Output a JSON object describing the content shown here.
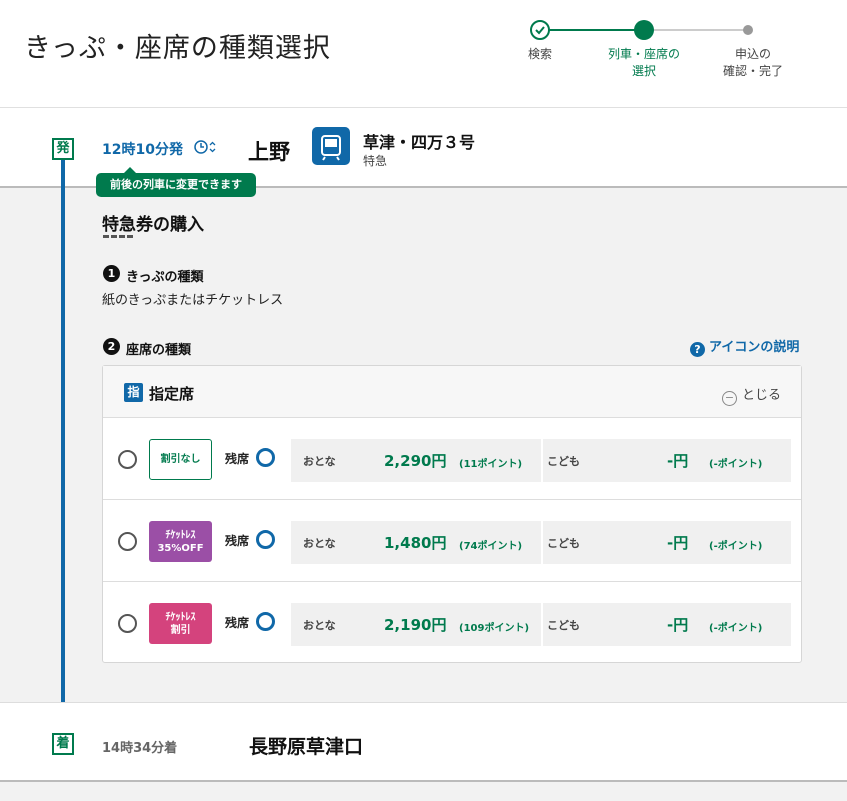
{
  "header": {
    "title": "きっぷ・座席の種類選択",
    "steps": [
      {
        "label": "検索",
        "state": "done"
      },
      {
        "label": "列車・座席の\n選択",
        "state": "current"
      },
      {
        "label": "申込の\n確認・完了",
        "state": "todo"
      }
    ]
  },
  "departure": {
    "badge": "発",
    "time": "12時10分発",
    "station": "上野",
    "train_name": "草津・四万３号",
    "train_type": "特急",
    "tooltip": "前後の列車に変更できます",
    "icons": [
      "clock-icon",
      "train-icon"
    ]
  },
  "purchase": {
    "title": "特急券の購入",
    "step1_num": "1",
    "step1_heading": "きっぷの種類",
    "ticket_kind": "紙のきっぷまたはチケットレス",
    "step2_num": "2",
    "step2_heading": "座席の種類",
    "icon_help": "アイコンの説明"
  },
  "seat_panel": {
    "icon_label": "指",
    "seat_class": "指定席",
    "collapse_label": "とじる",
    "fares": [
      {
        "tag": "割引なし",
        "tag_style": "normal",
        "avail_label": "残席",
        "adult_label": "おとな",
        "adult_price": "2,290円",
        "adult_points": "(11ポイント)",
        "child_label": "こども",
        "child_price": "-円",
        "child_points": "(-ポイント)"
      },
      {
        "tag": "ﾁｹｯﾄﾚｽ\n35%OFF",
        "tag_style": "purple",
        "avail_label": "残席",
        "adult_label": "おとな",
        "adult_price": "1,480円",
        "adult_points": "(74ポイント)",
        "child_label": "こども",
        "child_price": "-円",
        "child_points": "(-ポイント)"
      },
      {
        "tag": "ﾁｹｯﾄﾚｽ\n割引",
        "tag_style": "pink",
        "avail_label": "残席",
        "adult_label": "おとな",
        "adult_price": "2,190円",
        "adult_points": "(109ポイント)",
        "child_label": "こども",
        "child_price": "-円",
        "child_points": "(-ポイント)"
      }
    ]
  },
  "arrival": {
    "badge": "着",
    "time": "14時34分着",
    "station": "長野原草津口"
  },
  "colors": {
    "green": "#007a4d",
    "blue": "#1068a8",
    "purple_tag": "#9b4fa6",
    "pink_tag": "#d4437d"
  }
}
